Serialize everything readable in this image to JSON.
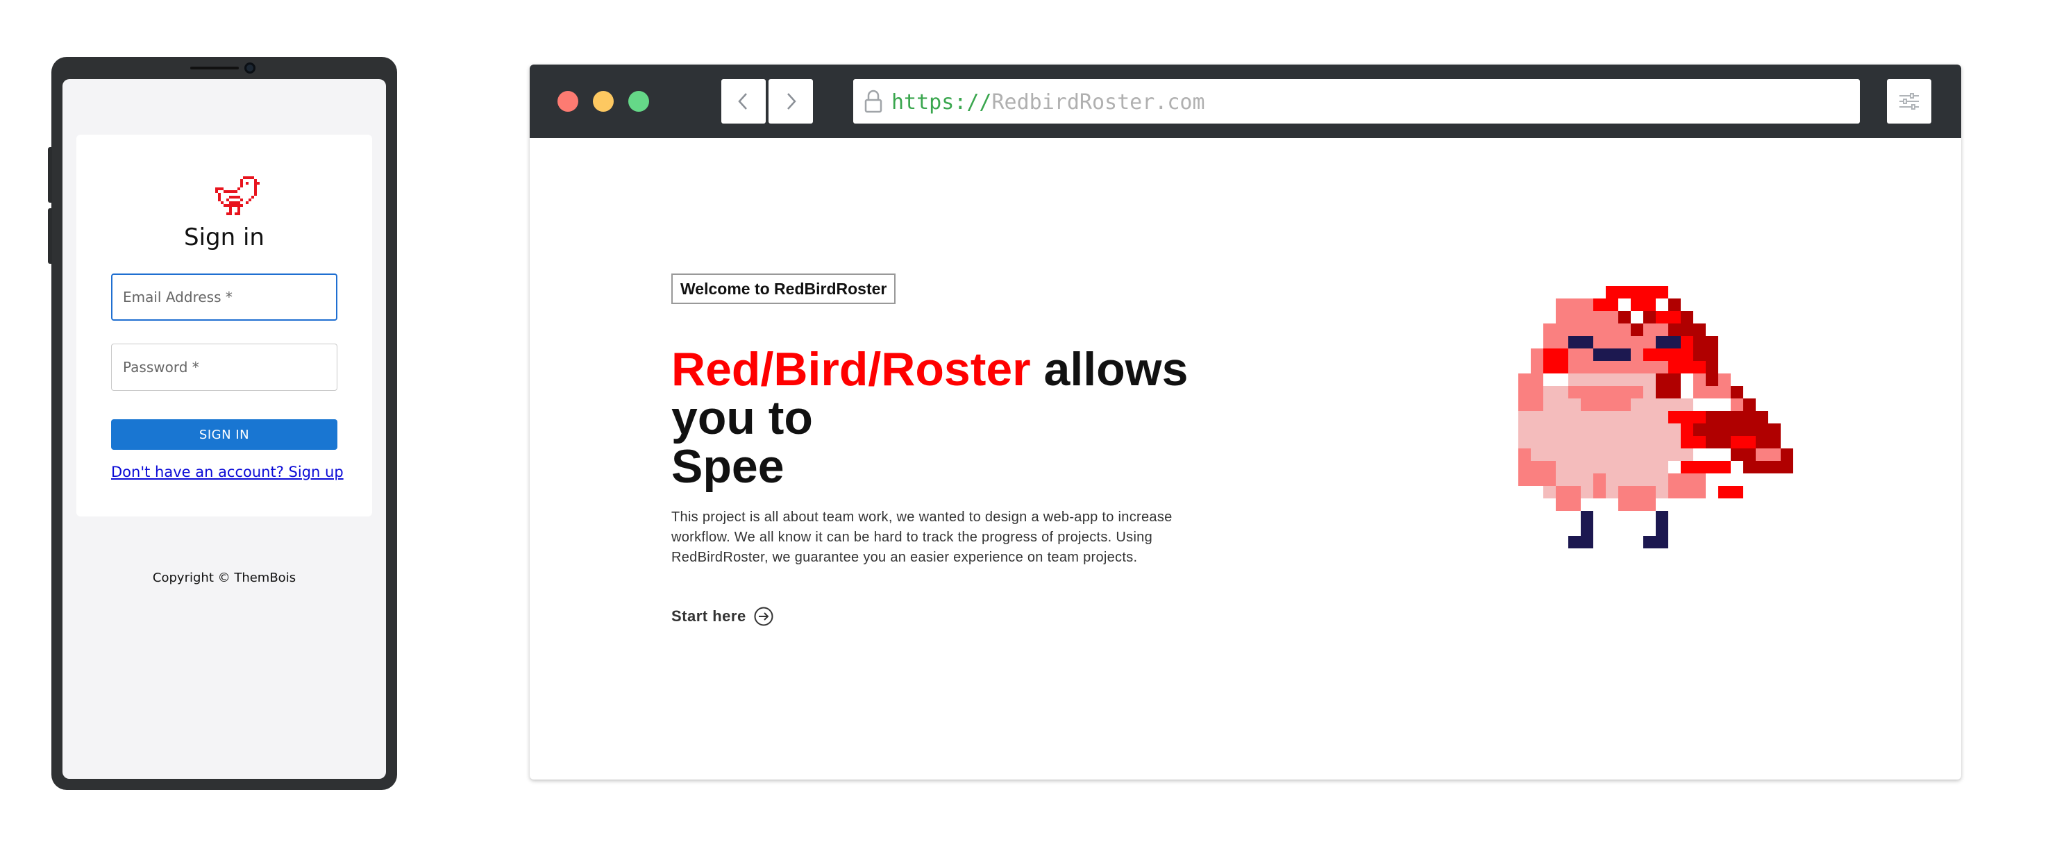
{
  "phone": {
    "signin": {
      "title": "Sign in",
      "email_placeholder": "Email Address *",
      "password_placeholder": "Password *",
      "button_label": "SIGN IN",
      "signup_link": "Don't have an account? Sign up"
    },
    "copyright": "Copyright © ThemBois"
  },
  "browser": {
    "url_scheme": "https://",
    "url_host": "RedbirdRoster.com",
    "page": {
      "badge": "Welcome to RedBirdRoster",
      "title_highlight": "Red/Bird/Roster",
      "title_rest_1": " allows",
      "title_line_2": "you to",
      "title_line_3": "Spee",
      "description": "This project is all about team work, we wanted to design a web-app to increase workflow. We all know it can be hard to track the progress of projects. Using RedBirdRoster, we guarantee you an easier experience on team projects.",
      "cta": "Start here"
    }
  },
  "colors": {
    "accent_red": "#ff0000",
    "button_blue": "#1976d2",
    "traffic_red": "#fd7b72",
    "traffic_yellow": "#fdc861",
    "traffic_green": "#65d888",
    "browser_bar": "#2e3236"
  },
  "icons": [
    "bird-logo-icon",
    "chevron-left-icon",
    "chevron-right-icon",
    "lock-icon",
    "sliders-icon",
    "arrow-right-circle-icon"
  ]
}
